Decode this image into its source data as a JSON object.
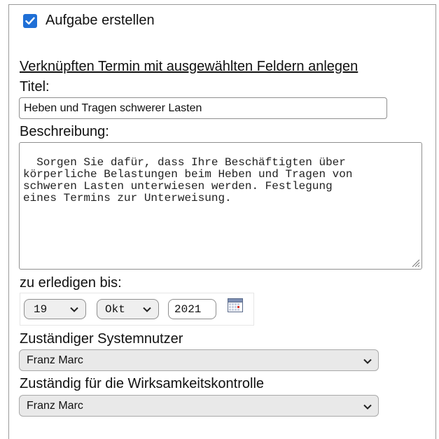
{
  "task": {
    "checkbox_label": "Aufgabe erstellen",
    "checked": true,
    "link_text": "Verknüpften Termin mit ausgewählten Feldern anlegen"
  },
  "title_field": {
    "label": "Titel:",
    "value": "Heben und Tragen schwerer Lasten"
  },
  "description_field": {
    "label": "Beschreibung:",
    "value": "Sorgen Sie dafür, dass Ihre Beschäftigten über\nkörperliche Belastungen beim Heben und Tragen von\nschweren Lasten unterwiesen werden. Festlegung\neines Termins zur Unterweisung."
  },
  "due_date": {
    "label": "zu erledigen bis:",
    "day": "19",
    "month": "Okt",
    "year": "2021",
    "calendar_icon": "calendar-icon"
  },
  "responsible_user": {
    "label": "Zuständiger Systemnutzer",
    "selected": "Franz Marc"
  },
  "effectiveness_control": {
    "label": "Zuständig für die Wirksamkeitskontrolle",
    "selected": "Franz Marc"
  },
  "colors": {
    "checkbox_blue": "#1f6fd6",
    "border_gray": "#8f8f8f",
    "select_bg": "#e9e9e9"
  }
}
